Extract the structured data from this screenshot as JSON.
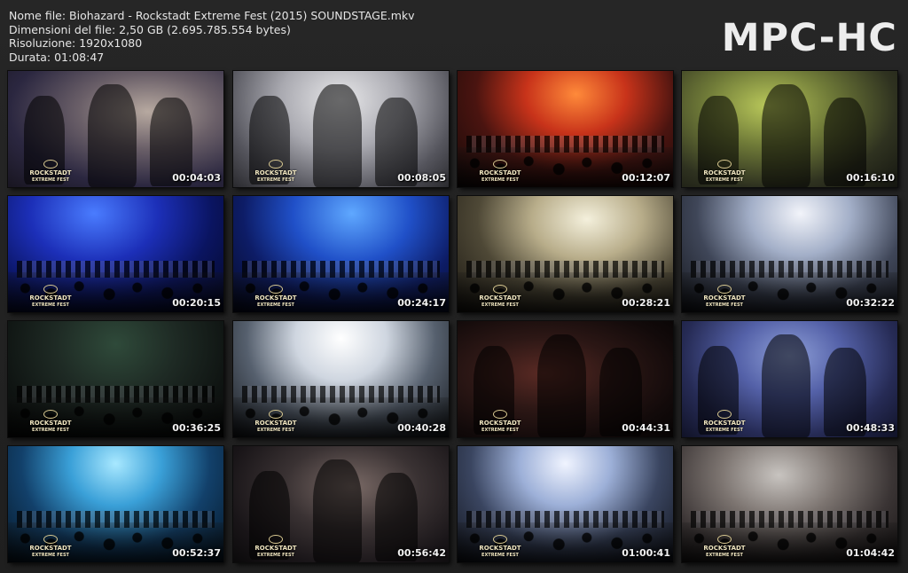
{
  "info": {
    "filename": "Nome file: Biohazard - Rockstadt Extreme Fest (2015) SOUNDSTAGE.mkv",
    "filesize": "Dimensioni del file: 2,50 GB (2.695.785.554 bytes)",
    "resolution": "Risoluzione: 1920x1080",
    "duration": "Durata: 01:08:47"
  },
  "brand": "MPC-HC",
  "thumbnails": [
    {
      "time": "00:04:03",
      "scene": "closeup-warm"
    },
    {
      "time": "00:08:05",
      "scene": "closeup-grey"
    },
    {
      "time": "00:12:07",
      "scene": "stage-red"
    },
    {
      "time": "00:16:10",
      "scene": "closeup-green"
    },
    {
      "time": "00:20:15",
      "scene": "stage-blue-dark"
    },
    {
      "time": "00:24:17",
      "scene": "stage-blue"
    },
    {
      "time": "00:28:21",
      "scene": "stage-smoke-warm"
    },
    {
      "time": "00:32:22",
      "scene": "stage-smoke-cool"
    },
    {
      "time": "00:36:25",
      "scene": "stage-dark-green"
    },
    {
      "time": "00:40:28",
      "scene": "stage-smoke-white"
    },
    {
      "time": "00:44:31",
      "scene": "dark-red"
    },
    {
      "time": "00:48:33",
      "scene": "closeup-blue"
    },
    {
      "time": "00:52:37",
      "scene": "stage-cyan"
    },
    {
      "time": "00:56:42",
      "scene": "closeup-dark-bass"
    },
    {
      "time": "01:00:41",
      "scene": "stage-smoke-blue"
    },
    {
      "time": "01:04:42",
      "scene": "stage-crowd-day"
    }
  ],
  "logo_text": "ROCKSTADT",
  "logo_sub": "EXTREME FEST"
}
